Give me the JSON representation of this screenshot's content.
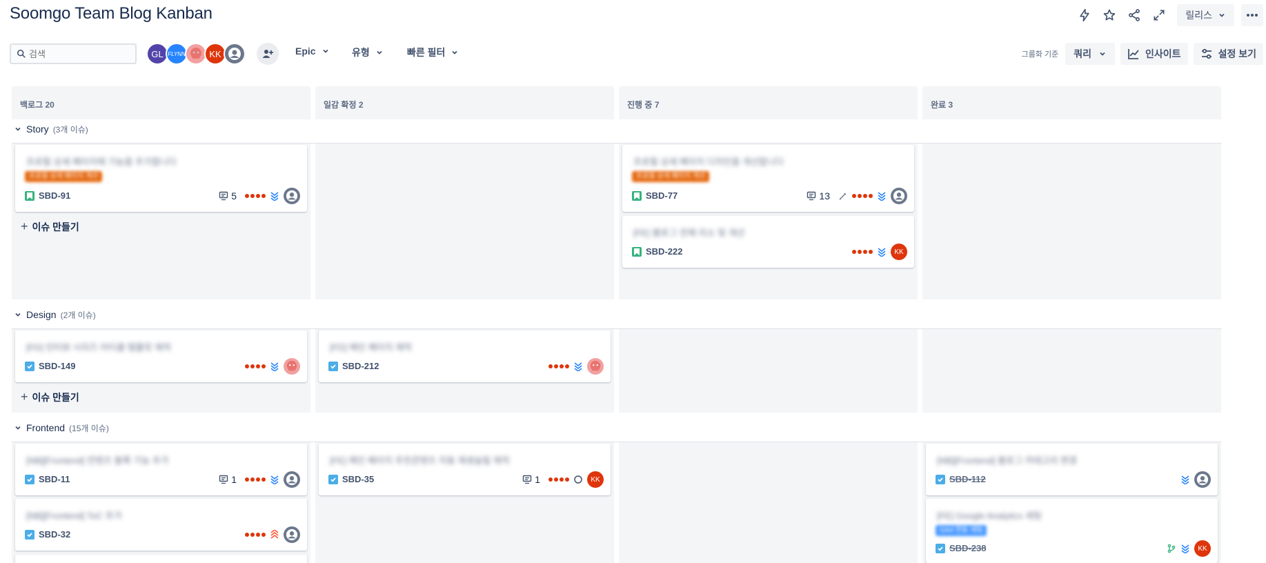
{
  "header": {
    "title": "Soomgo Team Blog Kanban",
    "release_label": "릴리스",
    "icons": [
      "lightning-icon",
      "star-icon",
      "share-icon",
      "fullscreen-icon",
      "more-icon"
    ]
  },
  "toolbar": {
    "search_placeholder": "검색",
    "avatars": [
      {
        "initials": "GL",
        "color": "#5243aa"
      },
      {
        "initials": "FLYNN",
        "color": "#2684ff"
      },
      {
        "initials": "",
        "color": "#e56910"
      },
      {
        "initials": "KK",
        "color": "#de350b"
      },
      {
        "initials": "",
        "color": "#6b778c"
      }
    ],
    "filters": [
      "Epic",
      "유형",
      "빠른 필터"
    ],
    "group_by_label": "그룹화 기준",
    "query_label": "쿼리",
    "insight_label": "인사이트",
    "settings_label": "설정 보기"
  },
  "columns": [
    {
      "title": "백로그",
      "count": "20"
    },
    {
      "title": "일감 확정",
      "count": "2"
    },
    {
      "title": "진행 중",
      "count": "7"
    },
    {
      "title": "완료",
      "count": "3"
    }
  ],
  "swimlanes": [
    {
      "name": "Story",
      "count": "(3개 이슈)"
    },
    {
      "name": "Design",
      "count": "(2개 이슈)"
    },
    {
      "name": "Frontend",
      "count": "(15개 이슈)"
    }
  ],
  "create_issue_label": "이슈 만들기",
  "cards": {
    "sbd91": {
      "summary": "프로필 상세 페이지에 기능을 추가합니다",
      "tag": "프로필 상세 페이지 개선",
      "key": "SBD-91",
      "comments": "5"
    },
    "sbd77": {
      "summary": "프로필 상세 페이지 디자인을 개선합니다",
      "tag": "프로필 상세 페이지 개선",
      "key": "SBD-77",
      "comments": "13"
    },
    "sbd222": {
      "summary": "[FE] 블로그 전체 리소 및 개선",
      "key": "SBD-222",
      "assignee": "KK"
    },
    "sbd149": {
      "summary": "[FD] 인터뷰 시리즈 아티클 템플릿 제작",
      "key": "SBD-149"
    },
    "sbd212": {
      "summary": "[FD] 메인 페이지 제작",
      "key": "SBD-212"
    },
    "sbd11": {
      "summary": "[NB][Frontend] 컨텐츠 블록 기능 추가",
      "key": "SBD-11",
      "comments": "1"
    },
    "sbd35": {
      "summary": "[FE] 메인 페이지 추천콘텐츠 자동 재생슬릴 제작",
      "key": "SBD-35",
      "comments": "1",
      "assignee": "KK"
    },
    "sbd112": {
      "summary": "[NB][Frontend] 블로그 카테고리 변경",
      "key": "SBD-112"
    },
    "sbd32": {
      "summary": "[NB][Frontend] ToC 추가",
      "key": "SBD-32"
    },
    "sbd238": {
      "summary": "[FE] Google Analytics 세팅",
      "tag": "GA4 연동 세팅",
      "key": "SBD-238",
      "assignee": "KK"
    }
  },
  "colors": {
    "story_icon": "#36b37e",
    "task_icon": "#4bade8",
    "priority_red": "#de350b",
    "story_tag": "#e56910",
    "ga_tag": "#4c9aff"
  }
}
